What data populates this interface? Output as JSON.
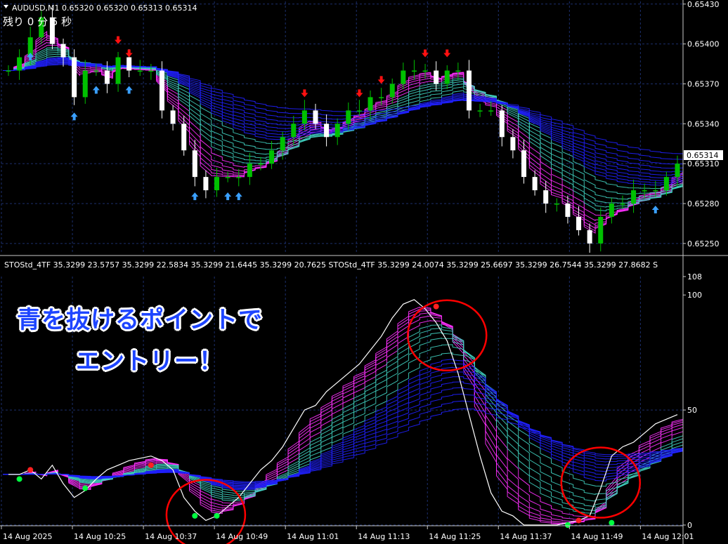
{
  "window": {
    "symbol_header": "AUDUSD,M1  0.65320 0.65320 0.65313 0.65314",
    "timer_text": "残り 0 分 5 秒",
    "current_price_tag": "0.65314"
  },
  "indicator_header": {
    "text": "STOStd_4TF 35.3299 23.5757 35.3299 22.5834 35.3299 21.6445 35.3299 20.7625  STOStd_4TF 35.3299 24.0074 35.3299 25.6697 35.3299 26.7544 35.3299 27.8682  S"
  },
  "annotation": {
    "line1": "青を抜けるポイントで",
    "line2": "エントリー！",
    "color": "#1e45ff"
  },
  "colors": {
    "background": "#000000",
    "bull_candle": "#00c000",
    "bear_candle": "#ffffff",
    "grid": "#1c2f6e",
    "ribbon_magenta": "#ff30ff",
    "ribbon_teal": "#40d0c0",
    "ribbon_blue": "#2020ff",
    "up_arrow": "#3aa0ff",
    "down_arrow": "#ff1010",
    "circle": "#ff0000",
    "dot_green": "#00ff40",
    "dot_red": "#ff2020"
  },
  "chart_data": [
    {
      "type": "candlestick",
      "title": "AUDUSD,M1",
      "price_ticks": [
        "0.65430",
        "0.65400",
        "0.65370",
        "0.65340",
        "0.65310",
        "0.65280",
        "0.65250"
      ],
      "price_ticks_values": [
        0.6543,
        0.654,
        0.6537,
        0.6534,
        0.6531,
        0.6528,
        0.6525
      ],
      "ylim": [
        0.65242,
        0.65432
      ],
      "current_price": 0.65314,
      "time_ticks": [
        "14 Aug 2025",
        "14 Aug 10:25",
        "14 Aug 10:37",
        "14 Aug 10:49",
        "14 Aug 11:01",
        "14 Aug 11:13",
        "14 Aug 11:25",
        "14 Aug 11:37",
        "14 Aug 11:49",
        "14 Aug 12:01"
      ],
      "close_path": [
        0.6538,
        0.6539,
        0.65405,
        0.6542,
        0.654,
        0.6539,
        0.6536,
        0.6538,
        0.6538,
        0.6537,
        0.6539,
        0.6538,
        0.6538,
        0.6538,
        0.6535,
        0.6534,
        0.6532,
        0.653,
        0.6529,
        0.653,
        0.653,
        0.653,
        0.6531,
        0.6531,
        0.6532,
        0.6533,
        0.6534,
        0.6535,
        0.6534,
        0.6533,
        0.6534,
        0.6535,
        0.6535,
        0.6536,
        0.6536,
        0.6537,
        0.6538,
        0.6538,
        0.6538,
        0.6537,
        0.6538,
        0.6538,
        0.6535,
        0.6535,
        0.6535,
        0.6533,
        0.6532,
        0.653,
        0.6529,
        0.6528,
        0.6528,
        0.6527,
        0.6526,
        0.6525,
        0.6527,
        0.6528,
        0.6528,
        0.6529,
        0.6529,
        0.6529,
        0.653,
        0.6531
      ],
      "up_arrow_bars": [
        2,
        6,
        8,
        11,
        17,
        20,
        21,
        59
      ],
      "down_arrow_bars": [
        10,
        11,
        27,
        32,
        34,
        38,
        40
      ]
    },
    {
      "type": "line",
      "title": "STOStd_4TF",
      "ylim": [
        0,
        108
      ],
      "y_ticks": [
        "108",
        "100",
        "50",
        "0"
      ],
      "y_ticks_values": [
        108,
        100,
        50,
        0
      ],
      "k_line": [
        22,
        22,
        24,
        20,
        26,
        18,
        12,
        15,
        20,
        24,
        26,
        28,
        29,
        30,
        28,
        24,
        12,
        6,
        2,
        4,
        8,
        12,
        18,
        24,
        28,
        34,
        42,
        50,
        52,
        58,
        62,
        66,
        70,
        76,
        82,
        90,
        96,
        98,
        94,
        88,
        80,
        66,
        48,
        30,
        14,
        6,
        4,
        0,
        0,
        0,
        0,
        1,
        2,
        4,
        16,
        30,
        34,
        36,
        40,
        44,
        46,
        48
      ],
      "circles_bar_index": [
        18,
        40,
        54
      ],
      "red_dots": [
        [
          2,
          24
        ],
        [
          13,
          26
        ],
        [
          39,
          95
        ],
        [
          52,
          2
        ]
      ],
      "green_dots": [
        [
          1,
          20
        ],
        [
          7,
          16
        ],
        [
          17,
          4
        ],
        [
          19,
          4
        ],
        [
          51,
          0
        ],
        [
          55,
          1
        ]
      ]
    }
  ]
}
